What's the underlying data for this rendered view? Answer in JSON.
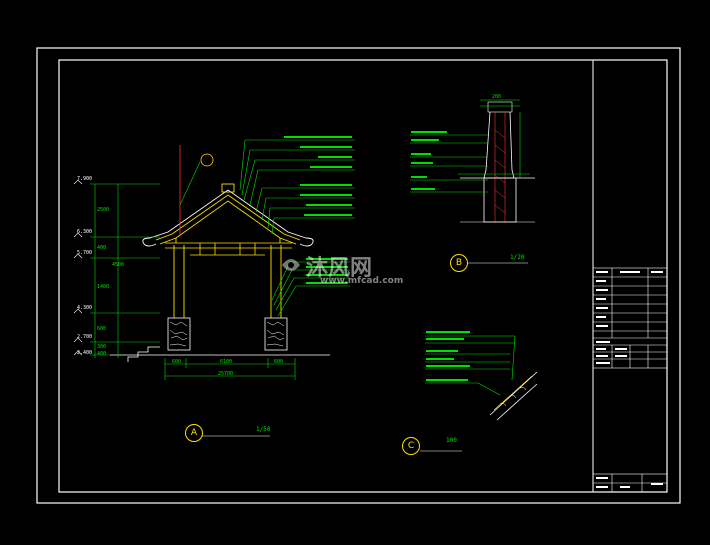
{
  "watermark": {
    "brand": "沐风网",
    "url": "www.mfcad.com"
  },
  "detail_a": {
    "marker": "A",
    "scale": "1/50"
  },
  "detail_b": {
    "marker": "B",
    "scale": "1/20",
    "top_dim": "200"
  },
  "detail_c": {
    "marker": "C",
    "scale": "100"
  },
  "elevations": [
    "7.900",
    "6.300",
    "5.700",
    "4.300",
    "2.700",
    "2.400"
  ],
  "vertical_dims": [
    "2500",
    "400",
    "1400",
    "600",
    "300",
    "400",
    "4500"
  ],
  "bottom_dims": {
    "left": "600",
    "middle": "6100",
    "right": "600",
    "total": "25700"
  }
}
